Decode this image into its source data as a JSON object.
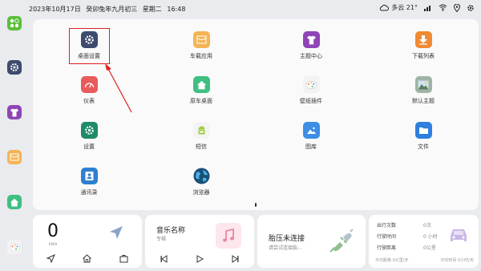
{
  "status": {
    "date": "2023年10月17日",
    "lunar": "癸卯兔年九月初三",
    "weekday": "星期二",
    "time": "16:48",
    "weather": "多云 21°"
  },
  "apps": [
    {
      "label": "桌面设置"
    },
    {
      "label": "车载应用"
    },
    {
      "label": "主题中心"
    },
    {
      "label": "下载列表"
    },
    {
      "label": "仪表"
    },
    {
      "label": "原车桌面"
    },
    {
      "label": "壁纸插件"
    },
    {
      "label": "默认主题"
    },
    {
      "label": "设置"
    },
    {
      "label": "短信"
    },
    {
      "label": "图库"
    },
    {
      "label": "文件"
    },
    {
      "label": "通讯录"
    },
    {
      "label": "浏览器"
    }
  ],
  "speed": {
    "value": "0",
    "unit": "KM/H"
  },
  "music": {
    "title": "音乐名称",
    "artist": "专辑"
  },
  "bt": {
    "title": "胎压未连接",
    "sub": "请尝试连接胎..."
  },
  "stats": {
    "rows": [
      {
        "label": "出行次数",
        "value": "0次"
      },
      {
        "label": "行驶时间",
        "value": "0 小时"
      },
      {
        "label": "行驶距离",
        "value": "0公里"
      }
    ],
    "avg_distance": "平均距离 0公里/天",
    "avg_time": "平均时间 0小时/天"
  },
  "colors": {
    "accent": "#e02020"
  }
}
